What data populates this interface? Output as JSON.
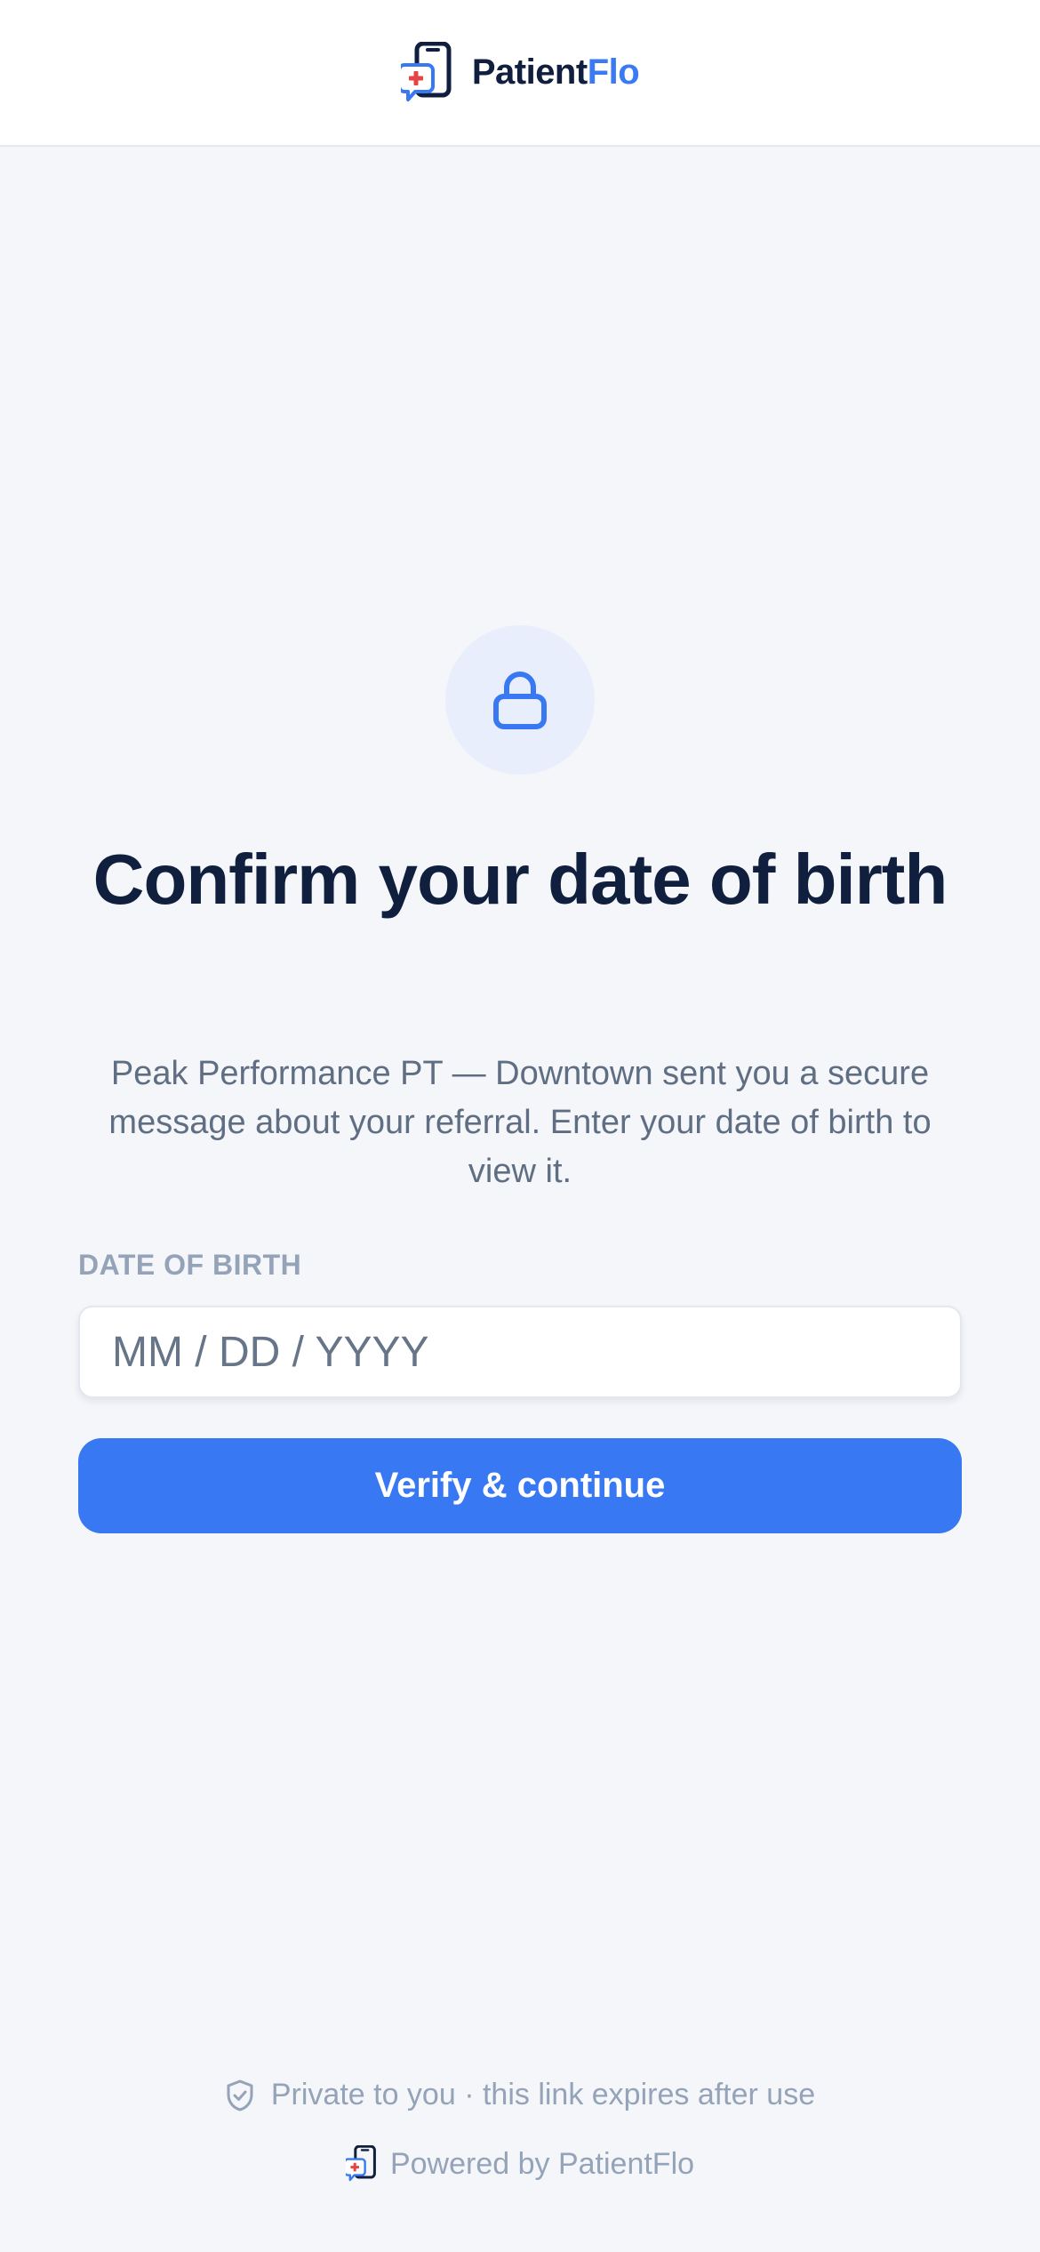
{
  "header": {
    "logo_icon": "patientflo-logo-icon",
    "brand_primary": "Patient",
    "brand_accent": "Flo"
  },
  "colors": {
    "brand_dark": "#0f1f3d",
    "accent_blue": "#3878f2",
    "logo_red": "#e64545",
    "background": "#f4f6fa",
    "muted_text": "#95a3b8"
  },
  "hero": {
    "icon": "lock-icon",
    "title": "Confirm your date of birth",
    "subtitle": "Peak Performance PT — Downtown sent you a secure message about your referral. Enter your date of birth to view it."
  },
  "form": {
    "dob_label": "DATE OF BIRTH",
    "dob_value": "",
    "dob_placeholder": "MM / DD / YYYY",
    "submit_label": "Verify & continue"
  },
  "footer": {
    "privacy_icon": "shield-check-icon",
    "privacy_text": "Private to you · this link expires after use",
    "powered_icon": "patientflo-logo-icon",
    "powered_text": "Powered by PatientFlo"
  }
}
